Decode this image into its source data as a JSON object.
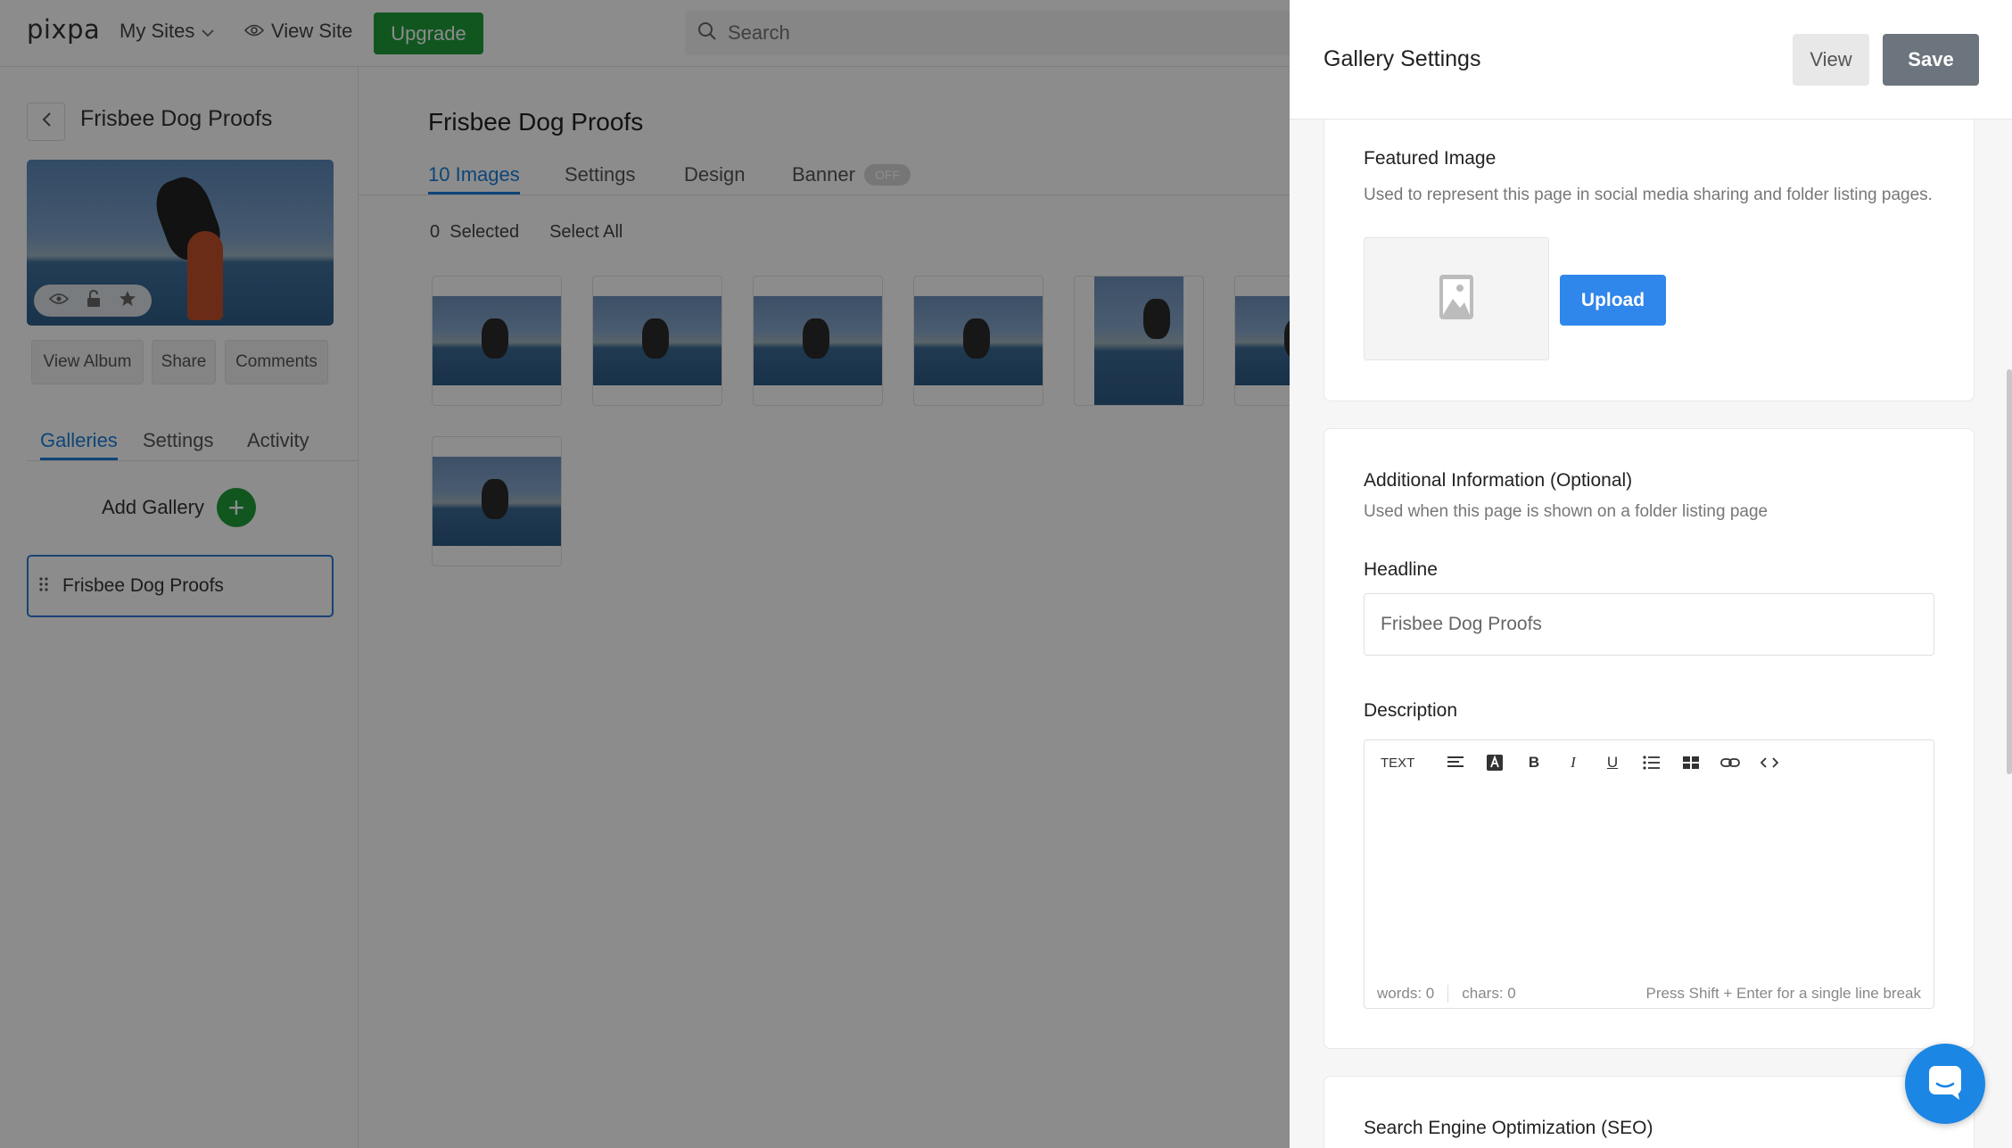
{
  "topbar": {
    "logo": "pixpa",
    "my_sites": "My Sites",
    "view_site": "View Site",
    "upgrade": "Upgrade",
    "search_placeholder": "Search"
  },
  "sidebar": {
    "album_title": "Frisbee Dog Proofs",
    "buttons": {
      "view_album": "View Album",
      "share": "Share",
      "comments": "Comments"
    },
    "tabs": [
      "Galleries",
      "Settings",
      "Activity"
    ],
    "active_tab": "Galleries",
    "add_gallery": "Add Gallery",
    "gallery_item": "Frisbee Dog Proofs"
  },
  "main": {
    "title": "Frisbee Dog Proofs",
    "tabs": [
      "10 Images",
      "Settings",
      "Design",
      "Banner"
    ],
    "banner_pill": "OFF",
    "selected_count": "0",
    "selected_label": "Selected",
    "select_all": "Select All"
  },
  "panel": {
    "title": "Gallery Settings",
    "view": "View",
    "save": "Save",
    "featured": {
      "title": "Featured Image",
      "desc": "Used to represent this page in social media sharing and folder listing pages.",
      "upload": "Upload"
    },
    "additional": {
      "title": "Additional Information (Optional)",
      "desc": "Used when this page is shown on a folder listing page",
      "headline_label": "Headline",
      "headline_value": "Frisbee Dog Proofs",
      "description_label": "Description",
      "toolbar_text": "TEXT",
      "words": "words: 0",
      "chars": "chars: 0",
      "hint": "Press Shift + Enter for a single line break"
    },
    "seo": {
      "title": "Search Engine Optimization (SEO)"
    }
  },
  "colors": {
    "accent_blue": "#2f86eb",
    "brand_green": "#1f9d3a",
    "save_gray": "#6c757d",
    "chat_blue": "#1b86e3"
  }
}
